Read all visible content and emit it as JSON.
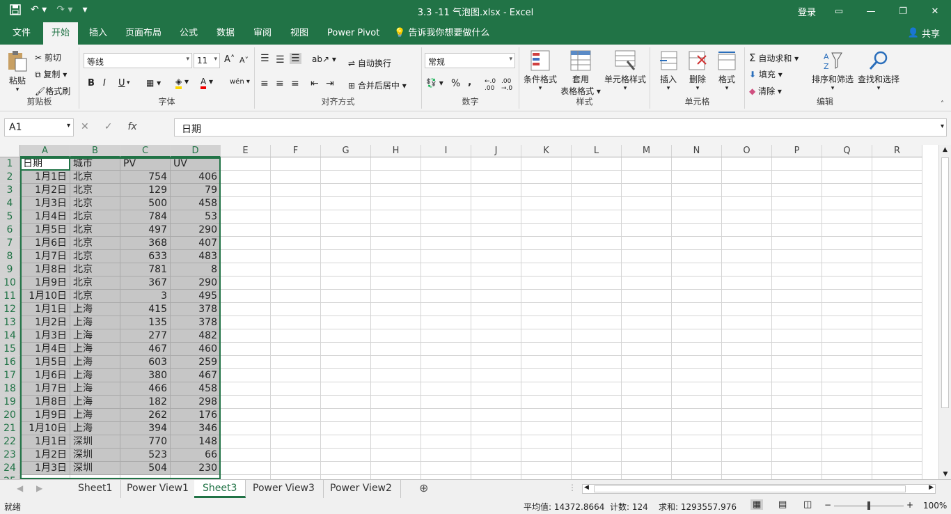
{
  "title": "3.3 -11 气泡图.xlsx  -  Excel",
  "login": "登录",
  "share": "共享",
  "tabs": [
    "文件",
    "开始",
    "插入",
    "页面布局",
    "公式",
    "数据",
    "审阅",
    "视图",
    "Power Pivot",
    "告诉我你想要做什么"
  ],
  "ribbon": {
    "clipboard": {
      "label": "剪贴板",
      "paste": "粘贴",
      "cut": "剪切",
      "copy": "复制",
      "format_painter": "格式刷"
    },
    "font": {
      "label": "字体",
      "name": "等线",
      "size": "11",
      "bold": "B",
      "italic": "I",
      "underline": "U",
      "wen": "wén"
    },
    "alignment": {
      "label": "对齐方式",
      "wrap": "自动换行",
      "merge": "合并后居中"
    },
    "number": {
      "label": "数字",
      "format": "常规",
      "percent": "%",
      "comma": ","
    },
    "styles": {
      "label": "样式",
      "conditional": "条件格式",
      "table_format_1": "套用",
      "table_format_2": "表格格式",
      "cell_styles": "单元格样式"
    },
    "cells": {
      "label": "单元格",
      "insert": "插入",
      "delete": "删除",
      "format": "格式"
    },
    "editing": {
      "label": "编辑",
      "autosum": "自动求和",
      "fill": "填充",
      "clear": "清除",
      "sort_filter": "排序和筛选",
      "find_select": "查找和选择"
    }
  },
  "formula_bar": {
    "name_box": "A1",
    "fx": "fx",
    "content": "日期"
  },
  "columns": [
    "A",
    "B",
    "C",
    "D",
    "E",
    "F",
    "G",
    "H",
    "I",
    "J",
    "K",
    "L",
    "M",
    "N",
    "O",
    "P",
    "Q",
    "R"
  ],
  "rows": [
    [
      "日期",
      "城市",
      "PV",
      "UV"
    ],
    [
      "1月1日",
      "北京",
      "754",
      "406"
    ],
    [
      "1月2日",
      "北京",
      "129",
      "79"
    ],
    [
      "1月3日",
      "北京",
      "500",
      "458"
    ],
    [
      "1月4日",
      "北京",
      "784",
      "53"
    ],
    [
      "1月5日",
      "北京",
      "497",
      "290"
    ],
    [
      "1月6日",
      "北京",
      "368",
      "407"
    ],
    [
      "1月7日",
      "北京",
      "633",
      "483"
    ],
    [
      "1月8日",
      "北京",
      "781",
      "8"
    ],
    [
      "1月9日",
      "北京",
      "367",
      "290"
    ],
    [
      "1月10日",
      "北京",
      "3",
      "495"
    ],
    [
      "1月1日",
      "上海",
      "415",
      "378"
    ],
    [
      "1月2日",
      "上海",
      "135",
      "378"
    ],
    [
      "1月3日",
      "上海",
      "277",
      "482"
    ],
    [
      "1月4日",
      "上海",
      "467",
      "460"
    ],
    [
      "1月5日",
      "上海",
      "603",
      "259"
    ],
    [
      "1月6日",
      "上海",
      "380",
      "467"
    ],
    [
      "1月7日",
      "上海",
      "466",
      "458"
    ],
    [
      "1月8日",
      "上海",
      "182",
      "298"
    ],
    [
      "1月9日",
      "上海",
      "262",
      "176"
    ],
    [
      "1月10日",
      "上海",
      "394",
      "346"
    ],
    [
      "1月1日",
      "深圳",
      "770",
      "148"
    ],
    [
      "1月2日",
      "深圳",
      "523",
      "66"
    ],
    [
      "1月3日",
      "深圳",
      "504",
      "230"
    ]
  ],
  "sheets": [
    "Sheet1",
    "Power View1",
    "Sheet3",
    "Power View3",
    "Power View2"
  ],
  "active_sheet": "Sheet3",
  "status": {
    "ready": "就绪",
    "average": "平均值: 14372.8664",
    "count": "计数: 124",
    "sum": "求和: 1293557.976",
    "zoom": "100%"
  }
}
